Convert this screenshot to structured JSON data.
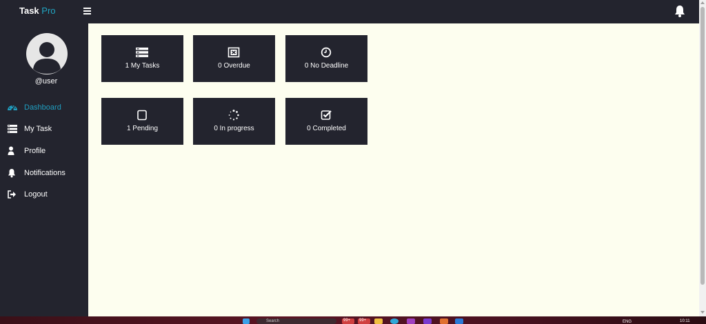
{
  "app": {
    "brand_main": "Task",
    "brand_accent": "Pro"
  },
  "colors": {
    "topbar": "#23242e",
    "sidebar": "#23242e",
    "content_bg": "#fdfeef",
    "card_bg": "#23242e",
    "accent": "#1f9fc1"
  },
  "header": {
    "menu_icon": "hamburger-menu-icon",
    "notification_icon": "bell-icon"
  },
  "user": {
    "username": "@user",
    "avatar_icon": "user-avatar-icon"
  },
  "sidebar": {
    "items": [
      {
        "label": "Dashboard",
        "icon": "dashboard-icon",
        "active": true
      },
      {
        "label": "My Task",
        "icon": "task-list-icon",
        "active": false
      },
      {
        "label": "Profile",
        "icon": "user-icon",
        "active": false
      },
      {
        "label": "Notifications",
        "icon": "bell-icon",
        "active": false
      },
      {
        "label": "Logout",
        "icon": "logout-icon",
        "active": false
      }
    ]
  },
  "cards": [
    {
      "label": "1 My Tasks",
      "icon": "task-list-icon"
    },
    {
      "label": "0 Overdue",
      "icon": "overdue-icon"
    },
    {
      "label": "0 No Deadline",
      "icon": "clock-icon"
    },
    {
      "label": "1 Pending",
      "icon": "square-icon"
    },
    {
      "label": "0 In progress",
      "icon": "spinner-icon"
    },
    {
      "label": "0 Completed",
      "icon": "check-square-icon"
    }
  ],
  "taskbar": {
    "search_placeholder": "Search",
    "badge_1": "99+",
    "badge_2": "99+",
    "language": "ENG",
    "time": "10:11"
  }
}
